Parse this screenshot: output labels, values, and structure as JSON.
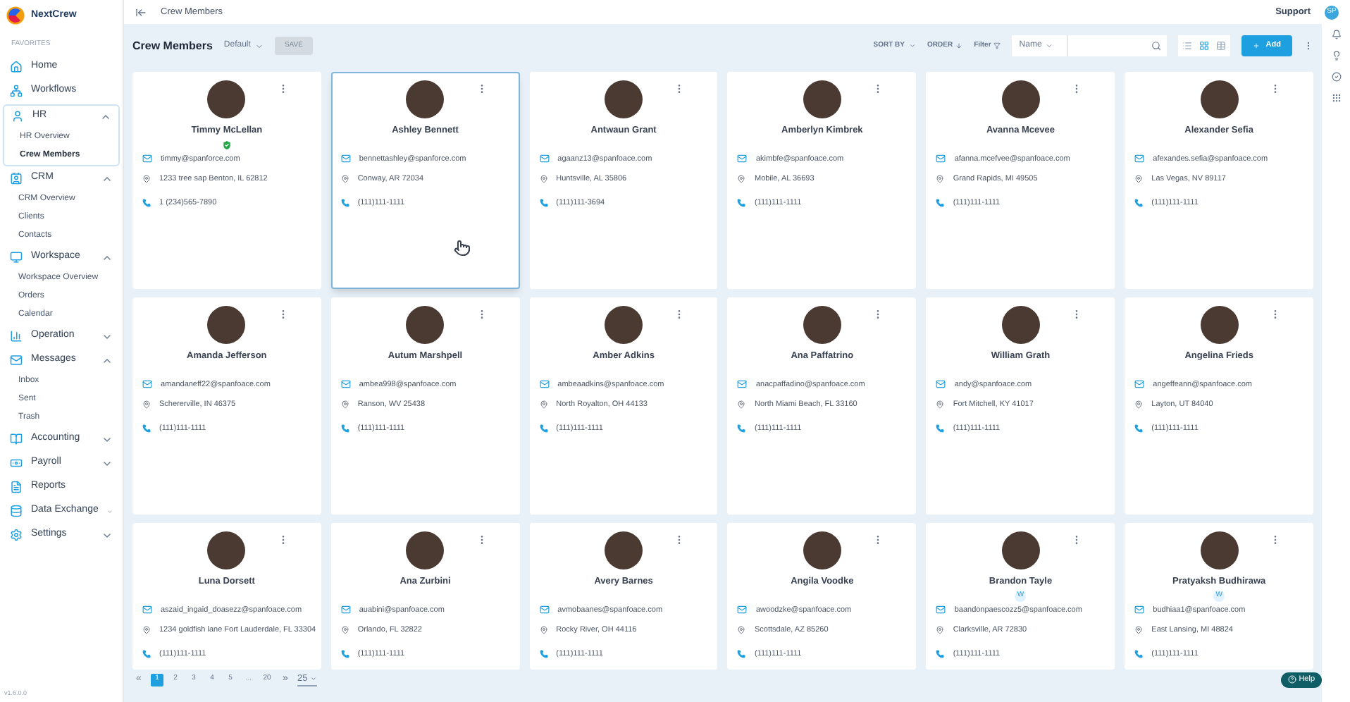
{
  "brand": "NextCrew",
  "sidebar": {
    "section_label": "FAVORITES",
    "items": [
      {
        "label": "Home"
      },
      {
        "label": "Workflows"
      },
      {
        "label": "HR",
        "expanded": true,
        "children": [
          {
            "label": "HR Overview",
            "selected": false
          },
          {
            "label": "Crew Members",
            "selected": true
          }
        ]
      },
      {
        "label": "CRM",
        "expanded": true,
        "children": [
          {
            "label": "CRM Overview",
            "selected": false
          },
          {
            "label": "Clients",
            "selected": false
          },
          {
            "label": "Contacts",
            "selected": false
          }
        ]
      },
      {
        "label": "Workspace",
        "expanded": true,
        "children": [
          {
            "label": "Workspace Overview",
            "selected": false
          },
          {
            "label": "Orders",
            "selected": false
          },
          {
            "label": "Calendar",
            "selected": false
          }
        ]
      },
      {
        "label": "Operation",
        "expanded": false
      },
      {
        "label": "Messages",
        "expanded": true,
        "children": [
          {
            "label": "Inbox",
            "selected": false
          },
          {
            "label": "Sent",
            "selected": false
          },
          {
            "label": "Trash",
            "selected": false
          }
        ]
      },
      {
        "label": "Accounting",
        "expanded": false
      },
      {
        "label": "Payroll",
        "expanded": false
      },
      {
        "label": "Reports"
      },
      {
        "label": "Data Exchange",
        "expanded": false
      },
      {
        "label": "Settings",
        "expanded": false
      }
    ],
    "version": "v1.6.0.0"
  },
  "breadcrumb": "Crew Members",
  "user": {
    "name": "Support",
    "initials": "SP"
  },
  "toolbar": {
    "title": "Crew Members",
    "view_name": "Default",
    "save_label": "SAVE",
    "save_disabled": true,
    "sort_label": "SORT BY",
    "order_label": "ORDER",
    "filter_label": "Filter",
    "field": "Name",
    "views": [
      {
        "kind": "list",
        "selected": false
      },
      {
        "kind": "grid",
        "selected": true
      },
      {
        "kind": "table",
        "selected": false
      }
    ],
    "add_label": "Add"
  },
  "cards": [
    {
      "name": "Timmy McLellan",
      "verified": true,
      "email": "timmy@spanforce.com",
      "address": "1233 tree sap Benton, IL 62812",
      "phone": "1 (234)565-7890",
      "selected": false
    },
    {
      "name": "Ashley Bennett",
      "verified": false,
      "email": "bennettashley@spanforce.com",
      "address": "Conway, AR 72034",
      "phone": "(111)111-1111",
      "selected": true
    },
    {
      "name": "Antwaun Grant",
      "verified": false,
      "email": "agaanz13@spanfoace.com",
      "address": "Huntsville, AL 35806",
      "phone": "(111)111-3694",
      "selected": false
    },
    {
      "name": "Amberlyn Kimbrek",
      "verified": false,
      "email": "akimbfe@spanfoace.com",
      "address": "Mobile, AL 36693",
      "phone": "(111)111-1111",
      "selected": false
    },
    {
      "name": "Avanna Mcevee",
      "verified": false,
      "email": "afanna.mcefvee@spanfoace.com",
      "address": "Grand Rapids, MI 49505",
      "phone": "(111)111-1111",
      "selected": false
    },
    {
      "name": "Alexander Sefia",
      "verified": false,
      "email": "afexandes.sefia@spanfoace.com",
      "address": "Las Vegas, NV 89117",
      "phone": "(111)111-1111",
      "selected": false
    },
    {
      "name": "Amanda Jefferson",
      "verified": false,
      "email": "amandaneff22@spanfoace.com",
      "address": "Schererville, IN 46375",
      "phone": "(111)111-1111",
      "selected": false
    },
    {
      "name": "Autum Marshpell",
      "verified": false,
      "email": "ambea998@spanfoace.com",
      "address": "Ranson, WV 25438",
      "phone": "(111)111-1111",
      "selected": false
    },
    {
      "name": "Amber Adkins",
      "verified": false,
      "email": "ambeaadkins@spanfoace.com",
      "address": "North Royalton, OH 44133",
      "phone": "(111)111-1111",
      "selected": false
    },
    {
      "name": "Ana Paffatrino",
      "verified": false,
      "email": "anacpaffadino@spanfoace.com",
      "address": "North Miami Beach, FL 33160",
      "phone": "(111)111-1111",
      "selected": false
    },
    {
      "name": "William Grath",
      "verified": false,
      "email": "andy@spanfoace.com",
      "address": "Fort Mitchell, KY 41017",
      "phone": "(111)111-1111",
      "selected": false
    },
    {
      "name": "Angelina Frieds",
      "verified": false,
      "email": "angeffeann@spanfoace.com",
      "address": "Layton, UT 84040",
      "phone": "(111)111-1111",
      "selected": false
    },
    {
      "name": "Luna Dorsett",
      "verified": false,
      "email": "aszaid_ingaid_doasezz@spanfoace.com",
      "address": "1234 goldfish lane Fort Lauderdale, FL 33304",
      "phone": "(111)111-1111",
      "selected": false
    },
    {
      "name": "Ana Zurbini",
      "verified": false,
      "email": "auabini@spanfoace.com",
      "address": "Orlando, FL 32822",
      "phone": "(111)111-1111",
      "selected": false
    },
    {
      "name": "Avery Barnes",
      "verified": false,
      "email": "avmobaanes@spanfoace.com",
      "address": "Rocky River, OH 44116",
      "phone": "(111)111-1111",
      "selected": false
    },
    {
      "name": "Angila Voodke",
      "verified": false,
      "email": "awoodzke@spanfoace.com",
      "address": "Scottsdale, AZ 85260",
      "phone": "(111)111-1111",
      "selected": false
    },
    {
      "name": "Brandon Tayle",
      "verified": false,
      "tag": "W",
      "email": "baandonpaescozz5@spanfoace.com",
      "address": "Clarksville, AR 72830",
      "phone": "(111)111-1111",
      "selected": false
    },
    {
      "name": "Pratyaksh Budhirawa",
      "verified": false,
      "tag": "W",
      "email": "budhiaa1@spanfoace.com",
      "address": "East Lansing, MI 48824",
      "phone": "(111)111-1111",
      "selected": false
    }
  ],
  "pagination": {
    "first": "«",
    "pages": [
      {
        "label": "1",
        "selected": true
      },
      {
        "label": "2",
        "selected": false
      },
      {
        "label": "3",
        "selected": false
      },
      {
        "label": "4",
        "selected": false
      },
      {
        "label": "5",
        "selected": false
      },
      {
        "label": "...",
        "selected": false
      },
      {
        "label": "20",
        "selected": false
      }
    ],
    "last": "»",
    "page_size": "25"
  },
  "help_label": "Help"
}
